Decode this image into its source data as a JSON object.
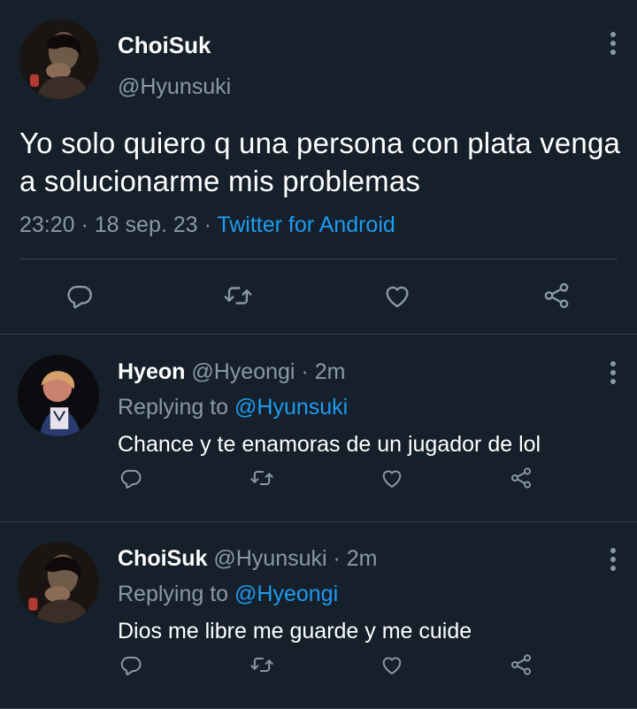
{
  "main_tweet": {
    "display_name": "ChoiSuk",
    "handle": "@Hyunsuki",
    "text": "Yo solo quiero q una persona con plata venga a solucionarme mis problemas",
    "time": "23:20",
    "date": "18 sep. 23",
    "source": "Twitter for Android",
    "actions": [
      "reply-icon",
      "retweet-icon",
      "like-icon",
      "share-icon"
    ]
  },
  "replies": [
    {
      "display_name": "Hyeon",
      "handle": "@Hyeongi",
      "age": "2m",
      "replying_prefix": "Replying to",
      "replying_to": "@Hyunsuki",
      "text": "Chance y te enamoras de un jugador de lol"
    },
    {
      "display_name": "ChoiSuk",
      "handle": "@Hyunsuki",
      "age": "2m",
      "replying_prefix": "Replying to",
      "replying_to": "@Hyeongi",
      "text": "Dios me libre me guarde y me cuide"
    }
  ],
  "colors": {
    "background": "#15202b",
    "accent": "#1d9bf0",
    "muted": "#8b98a5",
    "divider": "#38444d"
  }
}
